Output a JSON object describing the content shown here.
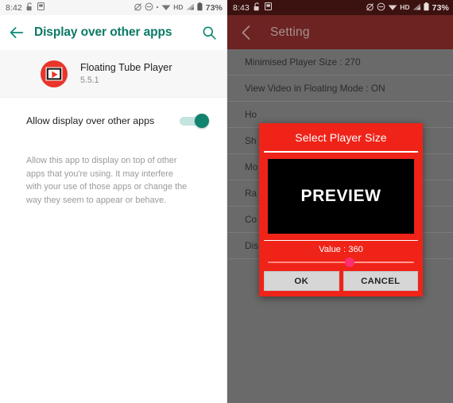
{
  "left": {
    "statusbar": {
      "time": "8:42",
      "left_icons": [
        "unlock-icon",
        "sim-card-icon"
      ],
      "right_icons": [
        "alarm-off-icon",
        "do-not-disturb-icon",
        "dot-icon",
        "wifi-icon",
        "hd-icon",
        "signal-icon",
        "battery-icon"
      ],
      "hd_label": "HD",
      "battery_percent": "73%"
    },
    "appbar": {
      "back_icon": "arrow-back-icon",
      "title": "Display over other apps",
      "search_icon": "search-icon",
      "title_color": "#0c7a66"
    },
    "app": {
      "icon": "floating-tube-player-icon",
      "name": "Floating Tube Player",
      "version": "5.5.1"
    },
    "toggle": {
      "label": "Allow display over other apps",
      "state": "on",
      "accent_color": "#12836f"
    },
    "description": "Allow this app to display on top of other apps that you're using. It may interfere with your use of those apps or change the way they seem to appear or behave."
  },
  "right": {
    "statusbar": {
      "time": "8:43",
      "left_icons": [
        "unlock-icon",
        "sim-card-icon"
      ],
      "right_icons": [
        "alarm-off-icon",
        "do-not-disturb-icon",
        "wifi-icon",
        "hd-icon",
        "signal-icon",
        "battery-icon"
      ],
      "hd_label": "HD",
      "battery_percent": "73%"
    },
    "appbar": {
      "back_icon": "chevron-left-icon",
      "title": "Setting",
      "bar_color": "#6c2321"
    },
    "settings_items": [
      "Minimised Player Size : 270",
      "View Video in Floating Mode : ON",
      "Ho",
      "Sh",
      "Mo",
      "Ra",
      "Co",
      "Dis"
    ],
    "dialog": {
      "title": "Select Player Size",
      "preview_label": "PREVIEW",
      "value_label": "Value : 360",
      "slider_percent": 56,
      "ok_label": "OK",
      "cancel_label": "CANCEL",
      "background_color": "#ef2318",
      "thumb_color": "#ff2e72"
    }
  }
}
